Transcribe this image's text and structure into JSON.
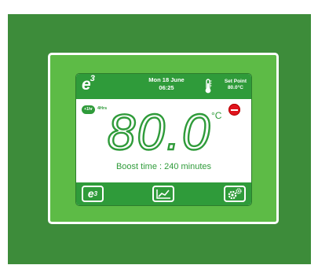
{
  "header": {
    "logo_text": "e",
    "logo_sup": "3",
    "date": "Mon 18 June",
    "time": "06:25",
    "setpoint_label": "Set Point",
    "setpoint_value": "80.0°C"
  },
  "display": {
    "timer_label": "+1hr",
    "timer_text": "4Hrs",
    "temperature": "80.0",
    "unit": "°C",
    "boost_text": "Boost time : 240 minutes"
  },
  "footer": {
    "home_label": "e",
    "home_sup": "3"
  },
  "colors": {
    "panel": "#3d8c3a",
    "bezel": "#5dbb46",
    "bar": "#2f9b3a",
    "alarm": "#e0141e"
  }
}
